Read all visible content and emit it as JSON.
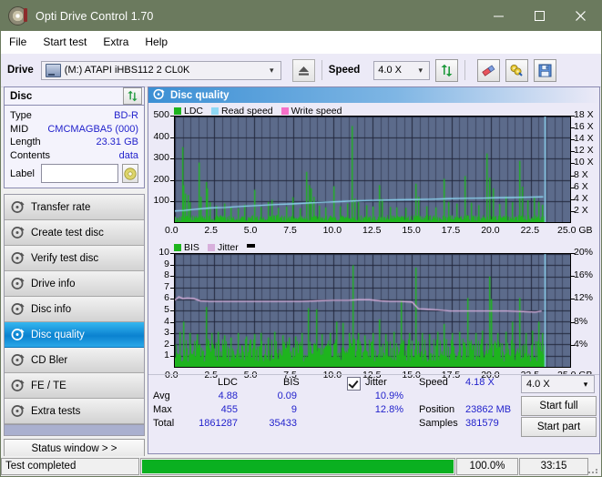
{
  "window": {
    "title": "Opti Drive Control 1.70",
    "icon": "disc-icon",
    "minimize": "minimize-icon",
    "maximize": "maximize-icon",
    "close": "close-icon",
    "titlebar_color": "#6b7a5e"
  },
  "menu": {
    "items": [
      "File",
      "Start test",
      "Extra",
      "Help"
    ]
  },
  "toolbar": {
    "drive_label": "Drive",
    "drive_value": "(M:)   ATAPI iHBS112  2 CL0K",
    "eject_icon": "eject-icon",
    "speed_label": "Speed",
    "speed_value": "4.0 X",
    "refresh_icon": "refresh-icon",
    "erase_icon": "eraser-icon",
    "tools_icon": "wrench-icon",
    "save_icon": "save-icon"
  },
  "disc": {
    "header": "Disc",
    "refresh_icon": "refresh-icon",
    "rows": [
      {
        "key": "Type",
        "value": "BD-R"
      },
      {
        "key": "MID",
        "value": "CMCMAGBA5 (000)"
      },
      {
        "key": "Length",
        "value": "23.31 GB"
      },
      {
        "key": "Contents",
        "value": "data"
      }
    ],
    "label_key": "Label",
    "label_value": "",
    "label_placeholder": "",
    "disc_icon": "cd-icon"
  },
  "nav": {
    "items": [
      {
        "label": "Transfer rate",
        "selected": false
      },
      {
        "label": "Create test disc",
        "selected": false
      },
      {
        "label": "Verify test disc",
        "selected": false
      },
      {
        "label": "Drive info",
        "selected": false
      },
      {
        "label": "Disc info",
        "selected": false
      },
      {
        "label": "Disc quality",
        "selected": true
      },
      {
        "label": "CD Bler",
        "selected": false
      },
      {
        "label": "FE / TE",
        "selected": false
      },
      {
        "label": "Extra tests",
        "selected": false
      }
    ],
    "status_window": "Status window > >"
  },
  "content": {
    "header": "Disc quality",
    "header_icon": "disc-quality-icon"
  },
  "stats": {
    "col_ldc": "LDC",
    "col_bis": "BIS",
    "jitter_label": "Jitter",
    "jitter_checked": true,
    "rows": [
      {
        "key": "Avg",
        "ldc": "4.88",
        "bis": "0.09",
        "jitter": "10.9%"
      },
      {
        "key": "Max",
        "ldc": "455",
        "bis": "9",
        "jitter": "12.8%"
      },
      {
        "key": "Total",
        "ldc": "1861287",
        "bis": "35433",
        "jitter": ""
      }
    ],
    "speed_label": "Speed",
    "speed_value": "4.18 X",
    "position_label": "Position",
    "position_value": "23862 MB",
    "samples_label": "Samples",
    "samples_value": "381579",
    "speed_select": "4.0 X",
    "start_full": "Start full",
    "start_part": "Start part"
  },
  "statusbar": {
    "message": "Test completed",
    "progress_percent": 100.0,
    "percent_text": "100.0%",
    "elapsed": "33:15"
  },
  "colors": {
    "ldc_green": "#1eb41e",
    "read_speed": "#8fd8f5",
    "write_speed": "#f56fc8",
    "jitter_pink": "#d8b0dc",
    "plot_bg": "#5c6b8b",
    "grid": "#2d3447",
    "accent_blue": "#2222cc",
    "progress_green": "#0ab020"
  },
  "chart_data": [
    {
      "type": "line",
      "name": "ldc-chart",
      "title": "",
      "legend": [
        {
          "label": "LDC",
          "color": "#1eb41e"
        },
        {
          "label": "Read speed",
          "color": "#8fd8f5"
        },
        {
          "label": "Write speed",
          "color": "#f56fc8"
        }
      ],
      "legend_position": "top-left",
      "xlabel": "GB",
      "x_ticks": [
        "0.0",
        "2.5",
        "5.0",
        "7.5",
        "10.0",
        "12.5",
        "15.0",
        "17.5",
        "20.0",
        "22.5",
        "25.0"
      ],
      "xlim": [
        0,
        25
      ],
      "ylabel": "",
      "y_ticks": [
        "100",
        "200",
        "300",
        "400",
        "500"
      ],
      "ylim": [
        0,
        500
      ],
      "y2_ticks": [
        "2 X",
        "4 X",
        "6 X",
        "8 X",
        "10 X",
        "12 X",
        "14 X",
        "16 X",
        "18 X"
      ],
      "y2lim": [
        0,
        18
      ],
      "grid": true,
      "series": [
        {
          "name": "LDC",
          "color": "#1eb41e",
          "style": "impulse",
          "baseline_avg": 18,
          "data_end_x": 23.4,
          "spikes": [
            [
              0.45,
              355
            ],
            [
              0.5,
              175
            ],
            [
              0.62,
              135
            ],
            [
              0.78,
              128
            ],
            [
              0.9,
              95
            ],
            [
              1.5,
              282
            ],
            [
              1.62,
              120
            ],
            [
              1.95,
              190
            ],
            [
              2.0,
              160
            ],
            [
              2.2,
              95
            ],
            [
              2.6,
              78
            ],
            [
              3.1,
              88
            ],
            [
              3.5,
              70
            ],
            [
              4.0,
              65
            ],
            [
              4.4,
              82
            ],
            [
              5.02,
              153
            ],
            [
              5.4,
              72
            ],
            [
              5.9,
              96
            ],
            [
              6.1,
              105
            ],
            [
              6.5,
              68
            ],
            [
              7.0,
              74
            ],
            [
              7.45,
              118
            ],
            [
              7.9,
              66
            ],
            [
              8.3,
              238
            ],
            [
              8.45,
              175
            ],
            [
              8.6,
              160
            ],
            [
              8.75,
              120
            ],
            [
              9.1,
              78
            ],
            [
              9.5,
              70
            ],
            [
              10.05,
              170
            ],
            [
              10.4,
              75
            ],
            [
              10.9,
              88
            ],
            [
              11.2,
              455
            ],
            [
              11.35,
              112
            ],
            [
              11.6,
              96
            ],
            [
              12.1,
              80
            ],
            [
              12.5,
              74
            ],
            [
              12.9,
              175
            ],
            [
              13.1,
              110
            ],
            [
              13.6,
              72
            ],
            [
              14.0,
              70
            ],
            [
              14.6,
              68
            ],
            [
              15.2,
              182
            ],
            [
              15.4,
              120
            ],
            [
              15.9,
              75
            ],
            [
              16.5,
              70
            ],
            [
              17.0,
              205
            ],
            [
              17.3,
              96
            ],
            [
              17.8,
              88
            ],
            [
              18.3,
              218
            ],
            [
              18.7,
              92
            ],
            [
              19.2,
              80
            ],
            [
              19.7,
              325
            ],
            [
              19.85,
              210
            ],
            [
              20.1,
              160
            ],
            [
              20.5,
              86
            ],
            [
              20.9,
              122
            ],
            [
              21.3,
              95
            ],
            [
              21.8,
              290
            ],
            [
              21.95,
              168
            ],
            [
              22.3,
              104
            ],
            [
              22.7,
              120
            ],
            [
              23.0,
              96
            ],
            [
              23.2,
              82
            ]
          ]
        },
        {
          "name": "Read speed",
          "color": "#8fd8f5",
          "style": "line",
          "points": [
            [
              0.0,
              1.9
            ],
            [
              0.6,
              2.0
            ],
            [
              1.3,
              2.2
            ],
            [
              2.2,
              2.4
            ],
            [
              3.2,
              2.5
            ],
            [
              4.3,
              2.7
            ],
            [
              5.4,
              2.85
            ],
            [
              6.4,
              3.0
            ],
            [
              7.4,
              3.1
            ],
            [
              8.4,
              3.25
            ],
            [
              9.4,
              3.4
            ],
            [
              10.4,
              3.5
            ],
            [
              11.3,
              3.6
            ],
            [
              12.4,
              3.7
            ],
            [
              13.0,
              3.75
            ],
            [
              14.1,
              3.8
            ],
            [
              15.1,
              3.85
            ],
            [
              16.2,
              3.9
            ],
            [
              17.3,
              4.0
            ],
            [
              18.4,
              4.05
            ],
            [
              19.5,
              4.1
            ],
            [
              20.3,
              4.15
            ],
            [
              21.4,
              4.2
            ],
            [
              22.3,
              4.25
            ],
            [
              23.3,
              4.3
            ]
          ],
          "end_marker_x": 23.4
        }
      ]
    },
    {
      "type": "line",
      "name": "bis-chart",
      "title": "",
      "legend": [
        {
          "label": "BIS",
          "color": "#1eb41e"
        },
        {
          "label": "Jitter",
          "color": "#d8b0dc"
        }
      ],
      "legend_position": "top-left",
      "xlabel": "GB",
      "x_ticks": [
        "0.0",
        "2.5",
        "5.0",
        "7.5",
        "10.0",
        "12.5",
        "15.0",
        "17.5",
        "20.0",
        "22.5",
        "25.0"
      ],
      "xlim": [
        0,
        25
      ],
      "y_ticks": [
        "1",
        "2",
        "3",
        "4",
        "5",
        "6",
        "7",
        "8",
        "9",
        "10"
      ],
      "ylim": [
        0,
        10
      ],
      "y2_ticks": [
        "4%",
        "8%",
        "12%",
        "16%",
        "20%"
      ],
      "y2lim": [
        0,
        20
      ],
      "grid": true,
      "series": [
        {
          "name": "BIS",
          "color": "#1eb41e",
          "style": "impulse",
          "baseline_avg": 1.35,
          "data_end_x": 23.4,
          "spikes": [
            [
              0.3,
              3.1
            ],
            [
              0.5,
              4.0
            ],
            [
              0.9,
              3.0
            ],
            [
              1.4,
              2.9
            ],
            [
              1.95,
              5.3
            ],
            [
              2.3,
              3.0
            ],
            [
              2.7,
              3.1
            ],
            [
              3.1,
              2.8
            ],
            [
              3.5,
              2.6
            ],
            [
              4.0,
              3.0
            ],
            [
              4.5,
              2.7
            ],
            [
              5.0,
              2.9
            ],
            [
              5.4,
              3.0
            ],
            [
              5.9,
              2.6
            ],
            [
              6.3,
              3.1
            ],
            [
              6.8,
              2.8
            ],
            [
              7.2,
              2.6
            ],
            [
              7.6,
              2.7
            ],
            [
              8.0,
              3.0
            ],
            [
              8.4,
              5.2
            ],
            [
              8.9,
              5.1
            ],
            [
              9.3,
              2.9
            ],
            [
              9.8,
              3.0
            ],
            [
              10.2,
              4.0
            ],
            [
              10.6,
              3.9
            ],
            [
              11.0,
              3.0
            ],
            [
              11.25,
              9.0
            ],
            [
              11.6,
              3.0
            ],
            [
              12.0,
              2.8
            ],
            [
              12.5,
              3.0
            ],
            [
              12.9,
              4.2
            ],
            [
              13.3,
              2.9
            ],
            [
              13.8,
              3.1
            ],
            [
              14.3,
              5.9
            ],
            [
              14.8,
              3.0
            ],
            [
              15.2,
              8.8
            ],
            [
              15.6,
              3.0
            ],
            [
              16.1,
              2.9
            ],
            [
              16.6,
              3.1
            ],
            [
              17.0,
              3.8
            ],
            [
              17.5,
              3.0
            ],
            [
              18.0,
              3.1
            ],
            [
              18.5,
              6.1
            ],
            [
              19.0,
              3.0
            ],
            [
              19.4,
              3.2
            ],
            [
              19.85,
              8.0
            ],
            [
              20.0,
              6.0
            ],
            [
              20.4,
              3.0
            ],
            [
              20.9,
              3.1
            ],
            [
              21.3,
              4.0
            ],
            [
              21.8,
              6.1
            ],
            [
              22.2,
              3.0
            ],
            [
              22.6,
              3.2
            ],
            [
              23.0,
              4.0
            ],
            [
              23.2,
              3.0
            ]
          ]
        },
        {
          "name": "Jitter",
          "color": "#d8b0dc",
          "style": "line",
          "unit": "%",
          "points": [
            [
              0.0,
              11.8
            ],
            [
              0.25,
              12.4
            ],
            [
              0.5,
              12.1
            ],
            [
              0.8,
              12.2
            ],
            [
              1.2,
              12.1
            ],
            [
              1.6,
              11.7
            ],
            [
              2.2,
              11.6
            ],
            [
              3.0,
              11.6
            ],
            [
              4.0,
              11.6
            ],
            [
              5.0,
              11.6
            ],
            [
              6.0,
              11.6
            ],
            [
              7.0,
              11.6
            ],
            [
              8.0,
              11.6
            ],
            [
              9.0,
              11.7
            ],
            [
              10.0,
              11.8
            ],
            [
              11.0,
              11.8
            ],
            [
              11.6,
              11.9
            ],
            [
              12.3,
              11.9
            ],
            [
              13.0,
              11.7
            ],
            [
              13.6,
              11.6
            ],
            [
              14.2,
              11.6
            ],
            [
              15.0,
              11.5
            ],
            [
              15.4,
              10.3
            ],
            [
              16.0,
              10.2
            ],
            [
              16.6,
              10.1
            ],
            [
              17.4,
              9.9
            ],
            [
              18.2,
              9.9
            ],
            [
              19.0,
              9.9
            ],
            [
              20.0,
              9.9
            ],
            [
              21.0,
              9.9
            ],
            [
              22.0,
              9.8
            ],
            [
              22.8,
              9.7
            ],
            [
              23.2,
              9.9
            ]
          ]
        }
      ]
    }
  ]
}
